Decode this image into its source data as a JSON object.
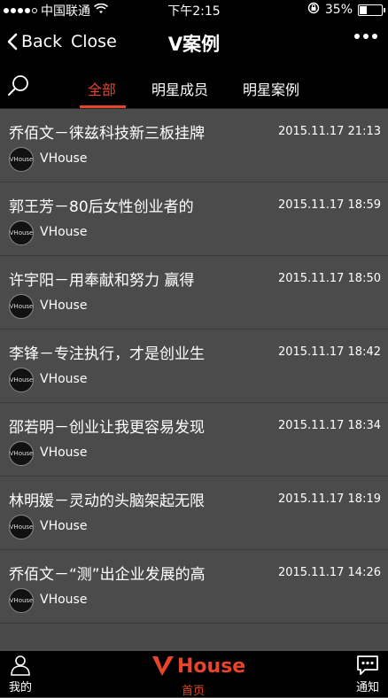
{
  "status": {
    "carrier": "中国联通",
    "time": "下午2:15",
    "battery": "35%",
    "battery_level": 0.35
  },
  "nav": {
    "back_label": "Back",
    "close_label": "Close",
    "title": "V案例"
  },
  "tabs": [
    {
      "label": "全部",
      "active": true
    },
    {
      "label": "明星成员",
      "active": false
    },
    {
      "label": "明星案例",
      "active": false
    }
  ],
  "items": [
    {
      "title": "乔佰文－徕兹科技新三板挂牌",
      "time": "2015.11.17 21:13",
      "source": "VHouse",
      "avatar_text": "VHouse"
    },
    {
      "title": "郭王芳－80后女性创业者的",
      "time": "2015.11.17 18:59",
      "source": "VHouse",
      "avatar_text": "VHouse"
    },
    {
      "title": "许宇阳－用奉献和努力 赢得",
      "time": "2015.11.17 18:50",
      "source": "VHouse",
      "avatar_text": "VHouse"
    },
    {
      "title": "李锋－专注执行，才是创业生",
      "time": "2015.11.17 18:42",
      "source": "VHouse",
      "avatar_text": "VHouse"
    },
    {
      "title": "邵若明－创业让我更容易发现",
      "time": "2015.11.17 18:34",
      "source": "VHouse",
      "avatar_text": "VHouse"
    },
    {
      "title": "林明媛－灵动的头脑架起无限",
      "time": "2015.11.17 18:19",
      "source": "VHouse",
      "avatar_text": "VHouse"
    },
    {
      "title": "乔佰文－“测”出企业发展的高",
      "time": "2015.11.17 14:26",
      "source": "VHouse",
      "avatar_text": "VHouse"
    }
  ],
  "bottom": {
    "me_label": "我的",
    "logo_text": "House",
    "home_label": "首页",
    "notify_label": "通知"
  },
  "colors": {
    "accent": "#e8442b",
    "list_bg": "#4b4b4b",
    "bar_bg": "#000000"
  }
}
